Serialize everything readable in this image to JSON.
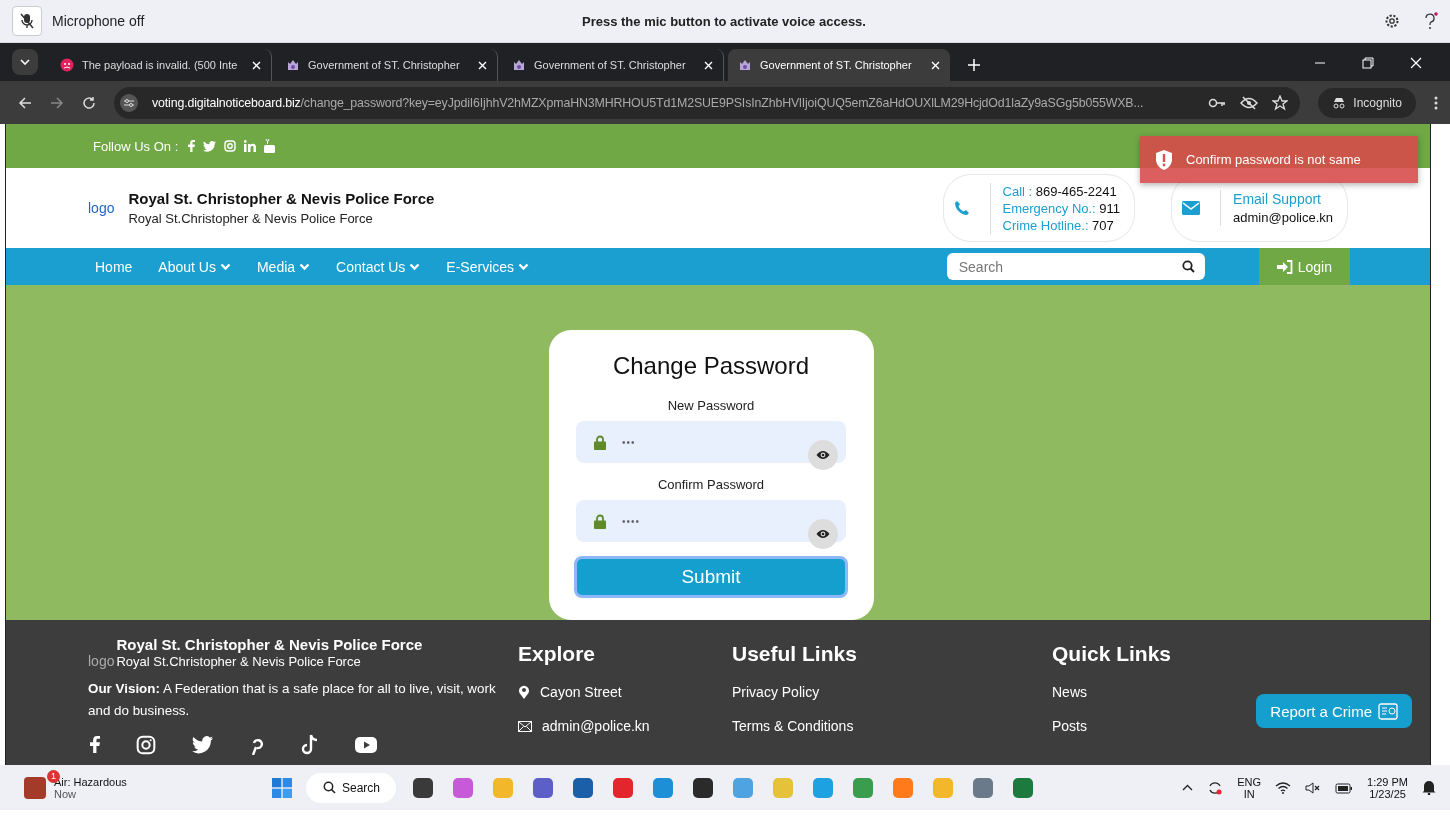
{
  "voice_bar": {
    "status": "Microphone off",
    "message": "Press the mic button to activate voice access."
  },
  "tabs": [
    {
      "title": "The payload is invalid. (500 Inte",
      "kind": "error",
      "selected": false
    },
    {
      "title": "Government of ST. Christopher",
      "kind": "site",
      "selected": false
    },
    {
      "title": "Government of ST. Christopher",
      "kind": "site",
      "selected": false
    },
    {
      "title": "Government of ST. Christopher",
      "kind": "site",
      "selected": true
    }
  ],
  "address_bar": {
    "host": "voting.digitalnoticeboard.biz",
    "path": "/change_password?key=eyJpdiI6IjhhV2hMZXpmaHN3MHRHOU5Td1M2SUE9PSIsInZhbHVlIjoiQUQ5emZ6aHdOUXlLM29HcjdOd1laZy9aSGg5b055WXB...",
    "profile": "Incognito"
  },
  "top_bar": {
    "follow_label": "Follow Us On :"
  },
  "toast": {
    "message": "Confirm password is not same"
  },
  "header": {
    "logo_alt": "logo",
    "title": "Royal St. Christopher & Nevis Police Force",
    "subtitle": "Royal St.Christopher & Nevis Police Force",
    "phones": [
      {
        "label": "Call :",
        "value": "869-465-2241"
      },
      {
        "label": "Emergency No.:",
        "value": "911"
      },
      {
        "label": "Crime Hotline.:",
        "value": "707"
      }
    ],
    "email": {
      "label": "Email Support",
      "value": "admin@police.kn"
    }
  },
  "nav": {
    "items": [
      {
        "label": "Home",
        "has_menu": false
      },
      {
        "label": "About Us",
        "has_menu": true
      },
      {
        "label": "Media",
        "has_menu": true
      },
      {
        "label": "Contact Us",
        "has_menu": true
      },
      {
        "label": "E-Services",
        "has_menu": true
      }
    ],
    "search": {
      "placeholder": "Search"
    },
    "login": "Login"
  },
  "form": {
    "title": "Change Password",
    "fields": [
      {
        "label": "New Password",
        "value": "•••"
      },
      {
        "label": "Confirm Password",
        "value": "••••"
      }
    ],
    "submit": "Submit"
  },
  "footer": {
    "logo_alt": "logo",
    "title": "Royal St. Christopher & Nevis Police Force",
    "subtitle": "Royal St.Christopher & Nevis Police Force",
    "vision": "**Our Vision:** A Federation that is a safe place for all to live, visit, work and do business.",
    "columns": [
      {
        "heading": "Explore",
        "links": [
          {
            "text": "Cayon Street",
            "kind": "location"
          },
          {
            "text": "admin@police.kn",
            "kind": "mail"
          }
        ]
      },
      {
        "heading": "Useful Links",
        "links": [
          {
            "text": "Privacy Policy",
            "kind": "plain"
          },
          {
            "text": "Terms & Conditions",
            "kind": "plain"
          }
        ]
      },
      {
        "heading": "Quick Links",
        "links": [
          {
            "text": "News",
            "kind": "plain"
          },
          {
            "text": "Posts",
            "kind": "plain"
          }
        ]
      }
    ],
    "report_button": "Report a Crime"
  },
  "taskbar": {
    "weather_badge": "1",
    "weather_title": "Air: Hazardous",
    "weather_sub": "Now",
    "search": "Search",
    "language": "ENG",
    "region": "IN",
    "time": "1:29 PM",
    "date": "1/23/25"
  }
}
